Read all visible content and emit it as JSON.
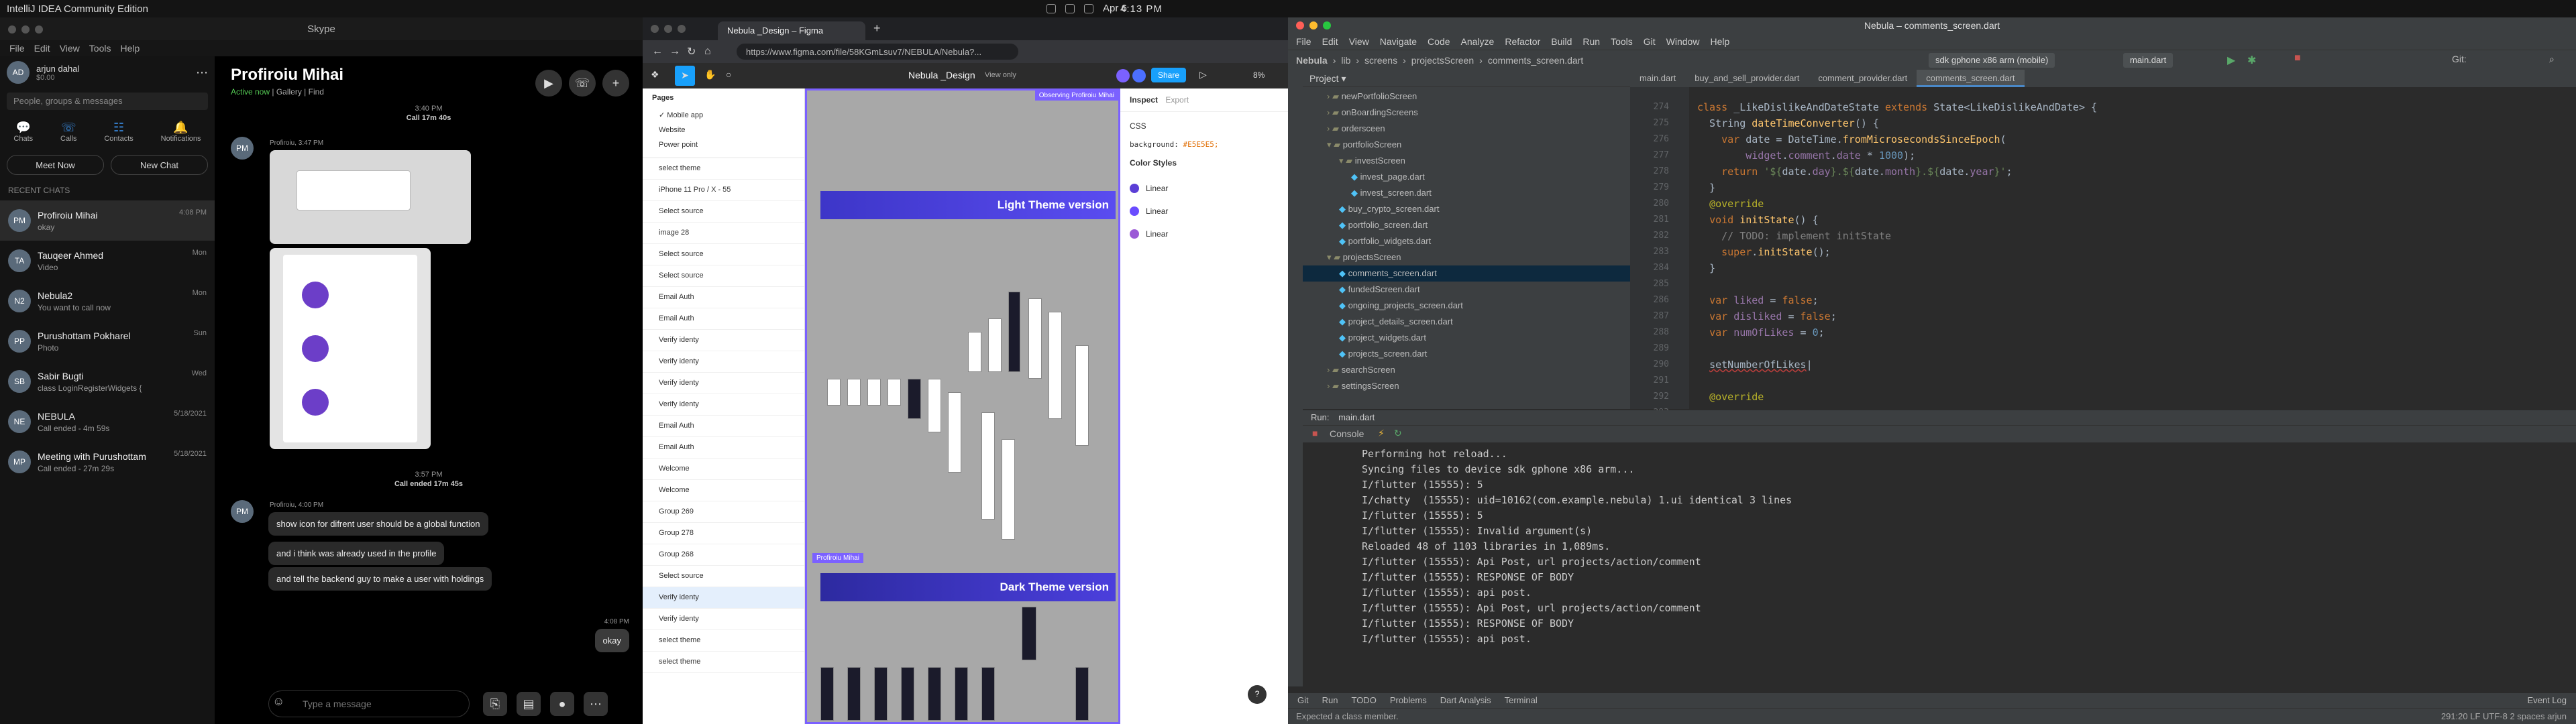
{
  "menubar": {
    "left": "IntelliJ IDEA Community Edition",
    "date": "Apr 6",
    "time": "4:13 PM"
  },
  "skype": {
    "title": "Skype",
    "menu": [
      "File",
      "Edit",
      "View",
      "Tools",
      "Help"
    ],
    "user": {
      "name": "arjun dahal",
      "balance": "$0.00"
    },
    "search_placeholder": "People, groups & messages",
    "nav": [
      "Chats",
      "Calls",
      "Contacts",
      "Notifications"
    ],
    "meet_now": "Meet Now",
    "new_chat": "New Chat",
    "recent_label": "RECENT CHATS",
    "chats": [
      {
        "name": "Profiroiu Mihai",
        "preview": "okay",
        "time": "4:08 PM",
        "initials": "PM"
      },
      {
        "name": "Tauqeer Ahmed",
        "preview": "Video",
        "time": "Mon",
        "initials": "TA"
      },
      {
        "name": "Nebula2",
        "preview": "You want to call now",
        "time": "Mon",
        "initials": "N2"
      },
      {
        "name": "Purushottam Pokharel",
        "preview": "Photo",
        "time": "Sun",
        "initials": "PP"
      },
      {
        "name": "Sabir Bugti",
        "preview": "class LoginRegisterWidgets {",
        "time": "Wed",
        "initials": "SB"
      },
      {
        "name": "NEBULA",
        "preview": "Call ended - 4m 59s",
        "time": "5/18/2021",
        "initials": "NE"
      },
      {
        "name": "Meeting with Purushottam",
        "preview": "Call ended - 27m 29s",
        "time": "5/18/2021",
        "initials": "MP"
      }
    ],
    "conv": {
      "name": "Profiroiu Mihai",
      "status": "Active now",
      "gallery": "Gallery",
      "find": "Find",
      "sys1_time": "3:40 PM",
      "sys1": "Call 17m 40s",
      "sender1": "Profiroiu, 3:47 PM",
      "sys2_time": "3:57 PM",
      "sys2": "Call ended 17m 45s",
      "sender2": "Profiroiu, 4:00 PM",
      "msgs": [
        "show icon for difrent user should be a global function",
        "and i think was already used in the profile",
        "and tell the backend guy to make a user with holdings"
      ],
      "reply_time": "4:08 PM",
      "reply": "okay",
      "compose": "Type a message"
    }
  },
  "figma": {
    "tab": "Nebula _Design – Figma",
    "url": "https://www.figma.com/file/58KGmLsuv7/NEBULA/Nebula?...",
    "file_title": "Nebula _Design",
    "view_only": "View only",
    "share": "Share",
    "zoom": "8%",
    "pages_label": "Pages",
    "pages": [
      "Mobile app",
      "Website",
      "Power point"
    ],
    "layers": [
      "select theme",
      "iPhone 11 Pro / X - 55",
      "Select source",
      "image 28",
      "Select source",
      "Select source",
      "Email Auth",
      "Email Auth",
      "Verify identy",
      "Verify identy",
      "Verify identy",
      "Verify identy",
      "Email Auth",
      "Email Auth",
      "Welcome",
      "Welcome",
      "Group 269",
      "Group 278",
      "Group 268",
      "Select source",
      "Verify identy",
      "Verify identy",
      "select theme",
      "select theme"
    ],
    "observing": "Observing Profiroiu Mihai",
    "light": "Light Theme version",
    "dark": "Dark Theme version",
    "cursor_label": "Profiroiu Mihai",
    "inspect": "Inspect",
    "export": "Export",
    "css": "CSS",
    "background_prop": "background:",
    "background_val": "#E5E5E5;",
    "color_styles": "Color Styles",
    "swatches": [
      {
        "name": "Linear",
        "color": "#5b3fd6"
      },
      {
        "name": "Linear",
        "color": "#6a4cff"
      },
      {
        "name": "Linear",
        "color": "#9b59d6"
      }
    ]
  },
  "intellij": {
    "title": "Nebula – comments_screen.dart",
    "menu": [
      "File",
      "Edit",
      "View",
      "Navigate",
      "Code",
      "Analyze",
      "Refactor",
      "Build",
      "Run",
      "Tools",
      "Git",
      "Window",
      "Help"
    ],
    "breadcrumb": [
      "Nebula",
      "lib",
      "screens",
      "projectsScreen",
      "comments_screen.dart"
    ],
    "device": "sdk gphone x86 arm (mobile)",
    "run_config": "main.dart",
    "project_label": "Project",
    "tree": [
      {
        "t": "newPortfolioScreen",
        "d": 2,
        "k": "folder"
      },
      {
        "t": "onBoardingScreens",
        "d": 2,
        "k": "folder"
      },
      {
        "t": "ordersceen",
        "d": 2,
        "k": "folder"
      },
      {
        "t": "portfolioScreen",
        "d": 2,
        "k": "folder-open"
      },
      {
        "t": "investScreen",
        "d": 3,
        "k": "folder-open"
      },
      {
        "t": "invest_page.dart",
        "d": 4,
        "k": "file"
      },
      {
        "t": "invest_screen.dart",
        "d": 4,
        "k": "file"
      },
      {
        "t": "buy_crypto_screen.dart",
        "d": 3,
        "k": "file"
      },
      {
        "t": "portfolio_screen.dart",
        "d": 3,
        "k": "file"
      },
      {
        "t": "portfolio_widgets.dart",
        "d": 3,
        "k": "file"
      },
      {
        "t": "projectsScreen",
        "d": 2,
        "k": "folder-open"
      },
      {
        "t": "comments_screen.dart",
        "d": 3,
        "k": "file",
        "sel": true
      },
      {
        "t": "fundedScreen.dart",
        "d": 3,
        "k": "file"
      },
      {
        "t": "ongoing_projects_screen.dart",
        "d": 3,
        "k": "file"
      },
      {
        "t": "project_details_screen.dart",
        "d": 3,
        "k": "file"
      },
      {
        "t": "project_widgets.dart",
        "d": 3,
        "k": "file"
      },
      {
        "t": "projects_screen.dart",
        "d": 3,
        "k": "file"
      },
      {
        "t": "searchScreen",
        "d": 2,
        "k": "folder"
      },
      {
        "t": "settingsScreen",
        "d": 2,
        "k": "folder"
      }
    ],
    "tabs": [
      "main.dart",
      "buy_and_sell_provider.dart",
      "comment_provider.dart",
      "comments_screen.dart"
    ],
    "active_tab": 3,
    "line_numbers": [
      "274",
      "275",
      "276",
      "277",
      "278",
      "279",
      "280",
      "281",
      "282",
      "283",
      "284",
      "285",
      "286",
      "287",
      "288",
      "289",
      "290",
      "291",
      "292",
      "293"
    ],
    "run_tab": "main.dart",
    "run_label": "Run:",
    "console_label": "Console",
    "console": [
      "Performing hot reload...",
      "Syncing files to device sdk gphone x86 arm...",
      "I/flutter (15555): 5",
      "I/chatty  (15555): uid=10162(com.example.nebula) 1.ui identical 3 lines",
      "I/flutter (15555): 5",
      "I/flutter (15555): Invalid argument(s)",
      "Reloaded 48 of 1103 libraries in 1,089ms.",
      "I/flutter (15555): Api Post, url projects/action/comment",
      "I/flutter (15555): RESPONSE OF BODY",
      "I/flutter (15555): api post.",
      "I/flutter (15555): Api Post, url projects/action/comment",
      "I/flutter (15555): RESPONSE OF BODY",
      "I/flutter (15555): api post."
    ],
    "bottom_tabs": [
      "Git",
      "Run",
      "TODO",
      "Problems",
      "Dart Analysis",
      "Terminal"
    ],
    "event_log": "Event Log",
    "status_msg": "Expected a class member.",
    "status_right": "291:20  LF  UTF-8  2 spaces  arjun"
  }
}
